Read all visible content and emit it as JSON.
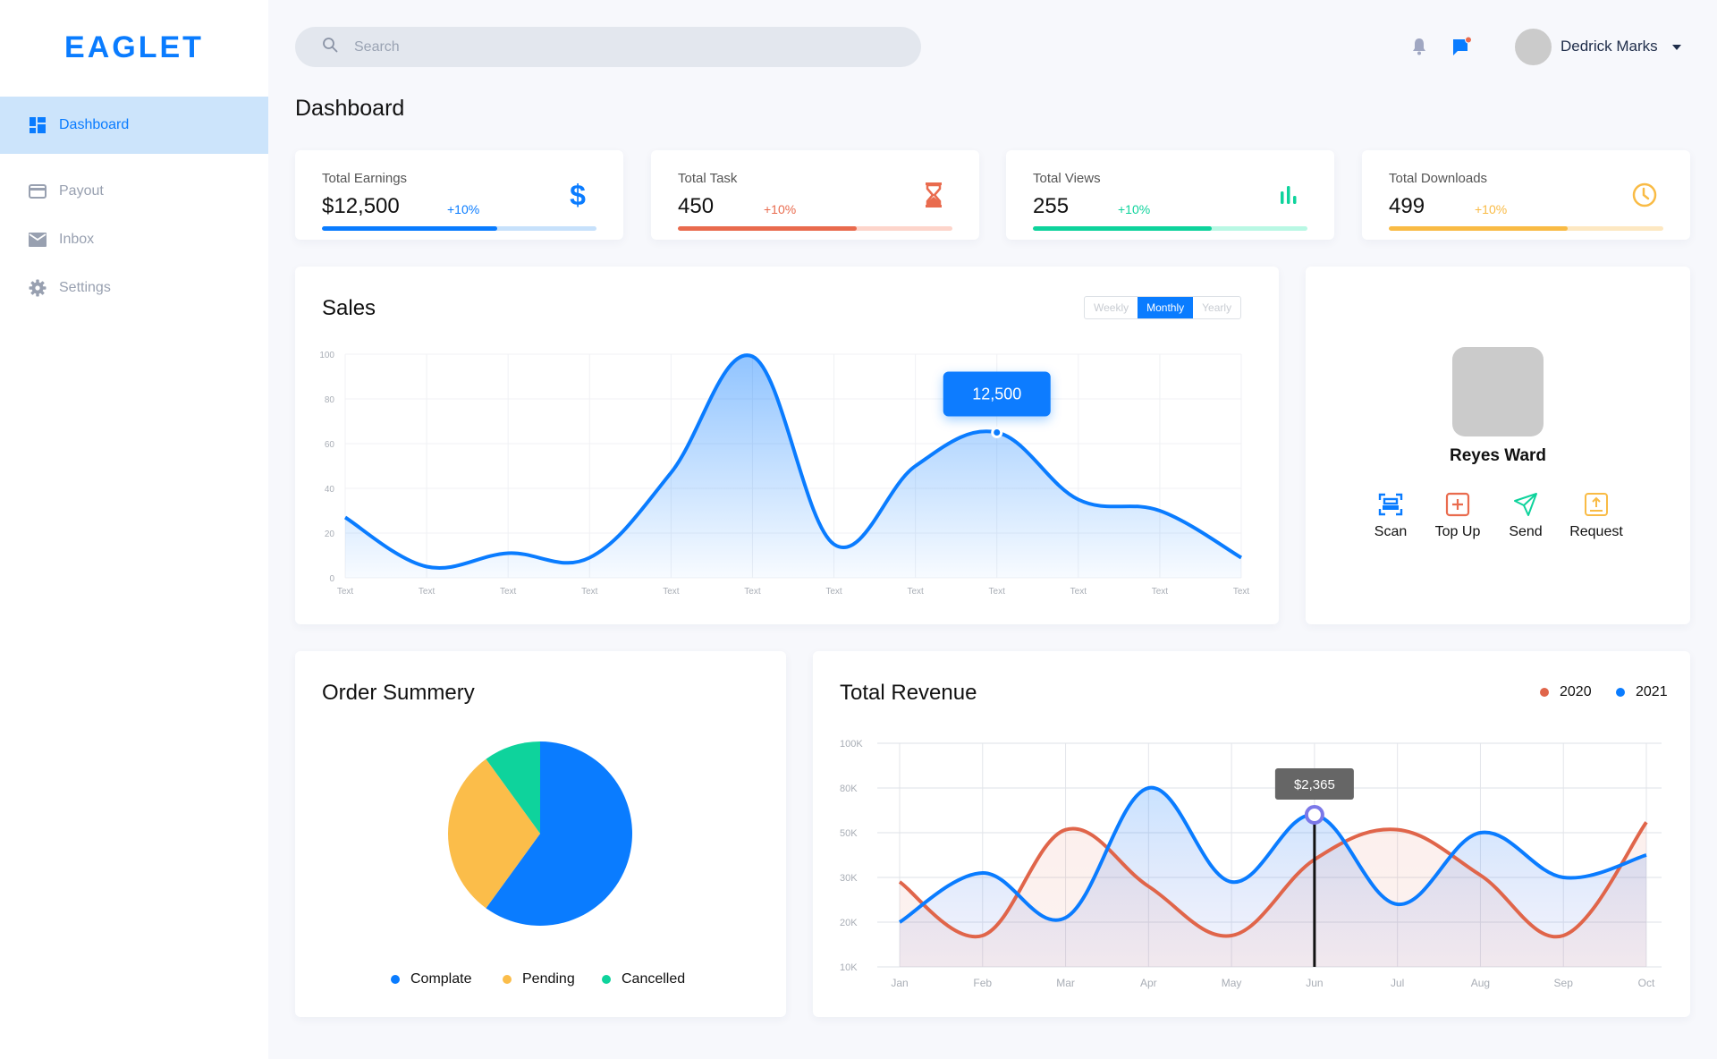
{
  "app": {
    "logo": "EAGLET"
  },
  "sidebar": {
    "items": [
      {
        "label": "Dashboard",
        "icon": "dashboard-icon",
        "active": true
      },
      {
        "label": "Payout",
        "icon": "credit-card-icon",
        "active": false
      },
      {
        "label": "Inbox",
        "icon": "mail-icon",
        "active": false
      },
      {
        "label": "Settings",
        "icon": "gear-icon",
        "active": false
      }
    ]
  },
  "header": {
    "search_placeholder": "Search",
    "search_value": "",
    "user_name": "Dedrick Marks",
    "notification_icon": "bell-icon",
    "message_icon": "chat-flag-icon",
    "has_unread_messages": true
  },
  "page": {
    "title": "Dashboard"
  },
  "stats": [
    {
      "label": "Total Earnings",
      "value": "$12,500",
      "delta": "+10%",
      "icon": "dollar-icon",
      "color": "#0a7cff",
      "track": "#c7e1fb",
      "progress": 0.64
    },
    {
      "label": "Total Task",
      "value": "450",
      "delta": "+10%",
      "icon": "hourglass-icon",
      "color": "#e96b4e",
      "track": "#fdd5cb",
      "progress": 0.65
    },
    {
      "label": "Total Views",
      "value": "255",
      "delta": "+10%",
      "icon": "bar-chart-icon",
      "color": "#0ed39c",
      "track": "#b9f8e4",
      "progress": 0.65
    },
    {
      "label": "Total Downloads",
      "value": "499",
      "delta": "+10%",
      "icon": "clock-icon",
      "color": "#f9bb45",
      "track": "#fde8c2",
      "progress": 0.65
    }
  ],
  "sales": {
    "title": "Sales",
    "periods": [
      {
        "label": "Weekly",
        "active": false
      },
      {
        "label": "Monthly",
        "active": true
      },
      {
        "label": "Yearly",
        "active": false
      }
    ],
    "tooltip": "12,500"
  },
  "profile": {
    "name": "Reyes Ward",
    "actions": [
      {
        "label": "Scan",
        "icon": "scan-icon",
        "color": "#0a7cff"
      },
      {
        "label": "Top Up",
        "icon": "plus-square-icon",
        "color": "#e96b4e"
      },
      {
        "label": "Send",
        "icon": "send-icon",
        "color": "#0ed39c"
      },
      {
        "label": "Request",
        "icon": "upload-icon",
        "color": "#f9bb45"
      }
    ]
  },
  "order": {
    "title": "Order Summery"
  },
  "revenue": {
    "title": "Total Revenue",
    "tooltip": "$2,365"
  },
  "chart_data": [
    {
      "id": "sales",
      "type": "area",
      "title": "Sales",
      "x": [
        "Text",
        "Text",
        "Text",
        "Text",
        "Text",
        "Text",
        "Text",
        "Text",
        "Text",
        "Text",
        "Text",
        "Text"
      ],
      "values": [
        27,
        5,
        11,
        9,
        47,
        99,
        15,
        50,
        65,
        35,
        30,
        9
      ],
      "yticks": [
        0,
        20,
        40,
        60,
        80,
        100
      ],
      "ylim": [
        0,
        100
      ],
      "grid": true,
      "color": "#0a7cff",
      "highlight_index": 8,
      "highlight_label": "12,500"
    },
    {
      "id": "order-summary",
      "type": "pie",
      "title": "Order Summery",
      "slices": [
        {
          "label": "Complate",
          "value": 60,
          "color": "#0a7cff"
        },
        {
          "label": "Pending",
          "value": 30,
          "color": "#fbbd4a"
        },
        {
          "label": "Cancelled",
          "value": 10,
          "color": "#0ed39c"
        }
      ],
      "legend": "bottom"
    },
    {
      "id": "total-revenue",
      "type": "area",
      "title": "Total Revenue",
      "categories": [
        "Jan",
        "Feb",
        "Mar",
        "Apr",
        "May",
        "Jun",
        "Jul",
        "Aug",
        "Sep",
        "Oct"
      ],
      "yticks": [
        "100K",
        "80K",
        "50K",
        "30K",
        "20K",
        "10K"
      ],
      "ytick_values": [
        100000,
        80000,
        50000,
        30000,
        20000,
        10000
      ],
      "series": [
        {
          "name": "2020",
          "color": "#e0654a",
          "values": [
            29000,
            17000,
            52000,
            28000,
            17000,
            38000,
            52000,
            31000,
            17000,
            57000
          ]
        },
        {
          "name": "2021",
          "color": "#0a7cff",
          "values": [
            20000,
            32000,
            21000,
            80000,
            29000,
            62000,
            24000,
            50000,
            30000,
            40000
          ]
        }
      ],
      "highlight": {
        "series": "2021",
        "category": "Jun",
        "label": "$2,365"
      },
      "legend": "top-right",
      "grid": true
    }
  ]
}
